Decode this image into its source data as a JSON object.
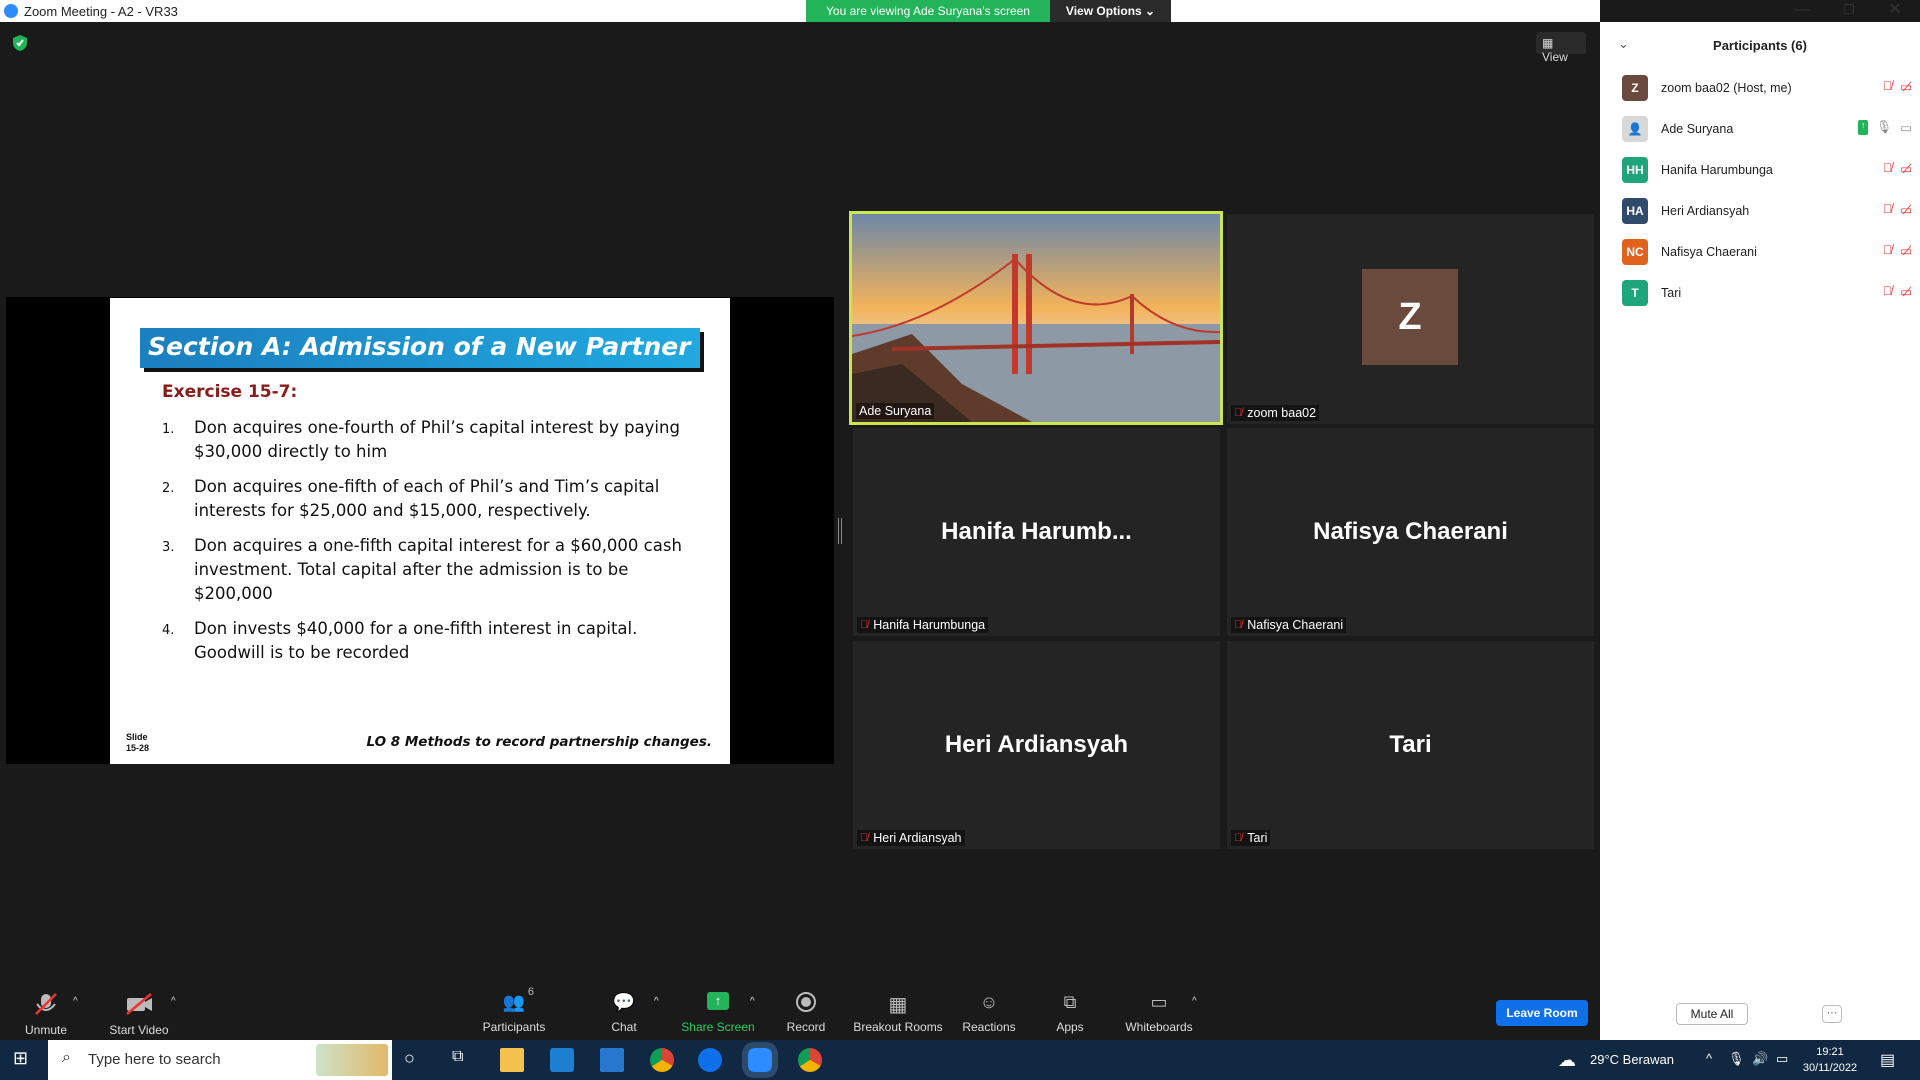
{
  "window": {
    "title": "Zoom Meeting - A2 - VR33",
    "banner": "You are viewing Ade Suryana's screen",
    "view_options": "View Options ⌄",
    "view": "View"
  },
  "slide": {
    "title": "Section A: Admission of a New Partner",
    "exercise": "Exercise 15-7:",
    "items": [
      {
        "n": "1.",
        "text": "Don acquires one-fourth of Phil’s capital interest by paying $30,000 directly to him"
      },
      {
        "n": "2.",
        "text": "Don acquires one-fifth of each of Phil’s and Tim’s capital interests for $25,000 and $15,000, respectively."
      },
      {
        "n": "3.",
        "text": "Don acquires a one-fifth capital interest for a $60,000 cash investment. Total capital after the admission is to be $200,000"
      },
      {
        "n": "4.",
        "text": "Don invests $40,000 for a one-fifth interest in capital. Goodwill is to be recorded"
      }
    ],
    "slide_label": "Slide",
    "slide_num": "15-28",
    "lo": "LO 8  Methods to record partnership changes."
  },
  "tiles": [
    {
      "big": "",
      "label": "Ade Suryana"
    },
    {
      "big": "Z",
      "label": "zoom baa02"
    },
    {
      "big": "Hanifa  Harumb...",
      "label": "Hanifa Harumbunga"
    },
    {
      "big": "Nafisya Chaerani",
      "label": "Nafisya Chaerani"
    },
    {
      "big": "Heri Ardiansyah",
      "label": "Heri Ardiansyah"
    },
    {
      "big": "Tari",
      "label": "Tari"
    }
  ],
  "toolbar": {
    "unmute": "Unmute",
    "start_video": "Start Video",
    "participants": "Participants",
    "participants_count": "6",
    "chat": "Chat",
    "share": "Share Screen",
    "record": "Record",
    "breakout": "Breakout Rooms",
    "reactions": "Reactions",
    "apps": "Apps",
    "whiteboards": "Whiteboards",
    "leave": "Leave Room"
  },
  "panel": {
    "title": "Participants (6)",
    "mute_all": "Mute All",
    "more": "···",
    "people": [
      {
        "initials": "Z",
        "name": "zoom baa02 (Host, me)",
        "color": "#6b4a3e"
      },
      {
        "initials": "",
        "name": "Ade Suryana",
        "color": "#888888"
      },
      {
        "initials": "HH",
        "name": "Hanifa Harumbunga",
        "color": "#1fa57a"
      },
      {
        "initials": "HA",
        "name": "Heri Ardiansyah",
        "color": "#2f4a6b"
      },
      {
        "initials": "NC",
        "name": "Nafisya Chaerani",
        "color": "#e0621c"
      },
      {
        "initials": "T",
        "name": "Tari",
        "color": "#1fa57a"
      }
    ]
  },
  "taskbar": {
    "search": "Type here to search",
    "weather": "29°C  Berawan",
    "time": "19:21",
    "date": "30/11/2022"
  }
}
